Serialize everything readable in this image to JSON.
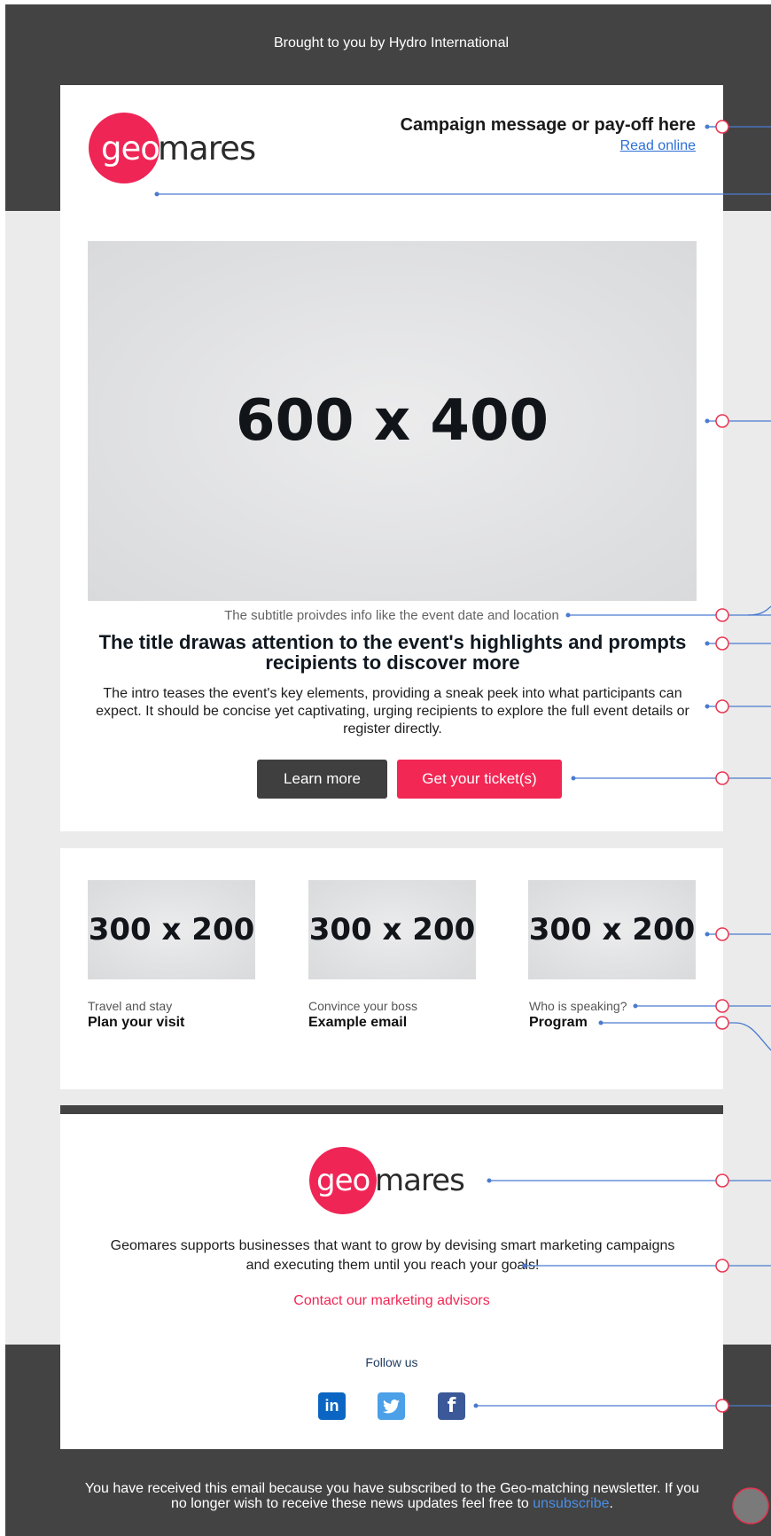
{
  "header": {
    "brought_by": "Brought to you by Hydro International",
    "logo": {
      "circle_text": "geo",
      "rest_text": "mares",
      "brand_color": "#ef2556"
    },
    "campaign_message": "Campaign message or pay-off here",
    "read_online": "Read online"
  },
  "hero": {
    "image_placeholder": "600 x 400",
    "subtitle": "The subtitle proivdes info like the event date and location",
    "title": "The title drawas attention to the event's highlights and prompts recipients to discover more",
    "intro": "The intro teases the event's key elements, providing a sneak peek into what participants can expect. It should be concise yet captivating, urging recipients to explore the full event details or register directly.",
    "buttons": {
      "learn_more": "Learn more",
      "get_tickets": "Get your ticket(s)"
    }
  },
  "columns": [
    {
      "image_placeholder": "300 x 200",
      "kicker": "Travel and stay",
      "heading": "Plan your visit"
    },
    {
      "image_placeholder": "300 x 200",
      "kicker": "Convince your boss",
      "heading": "Example email"
    },
    {
      "image_placeholder": "300 x 200",
      "kicker": "Who is speaking?",
      "heading": "Program"
    }
  ],
  "footer": {
    "logo": {
      "circle_text": "geo",
      "rest_text": "mares"
    },
    "about": "Geomares supports businesses that want to grow by devising smart marketing campaigns and executing them until you reach your goals!",
    "contact_link": "Contact our marketing advisors",
    "follow_us": "Follow us",
    "social": [
      {
        "icon": "linkedin-icon",
        "glyph": "in",
        "color": "#0a66c2"
      },
      {
        "icon": "twitter-icon",
        "glyph": "🐦",
        "color": "#4ba0e8"
      },
      {
        "icon": "facebook-icon",
        "glyph": "f",
        "color": "#3b5998"
      }
    ],
    "legal_text": "You have received this email because you have subscribed to the Geo-matching newsletter. If you no longer wish to receive these news updates feel free to",
    "unsubscribe": "unsubscribe",
    "legal_end": "."
  },
  "colors": {
    "dark_band": "#434343",
    "light_band": "#ebebeb",
    "accent": "#f22754",
    "annotation_line": "#4a7bd0",
    "annotation_marker": "#e8334f"
  }
}
